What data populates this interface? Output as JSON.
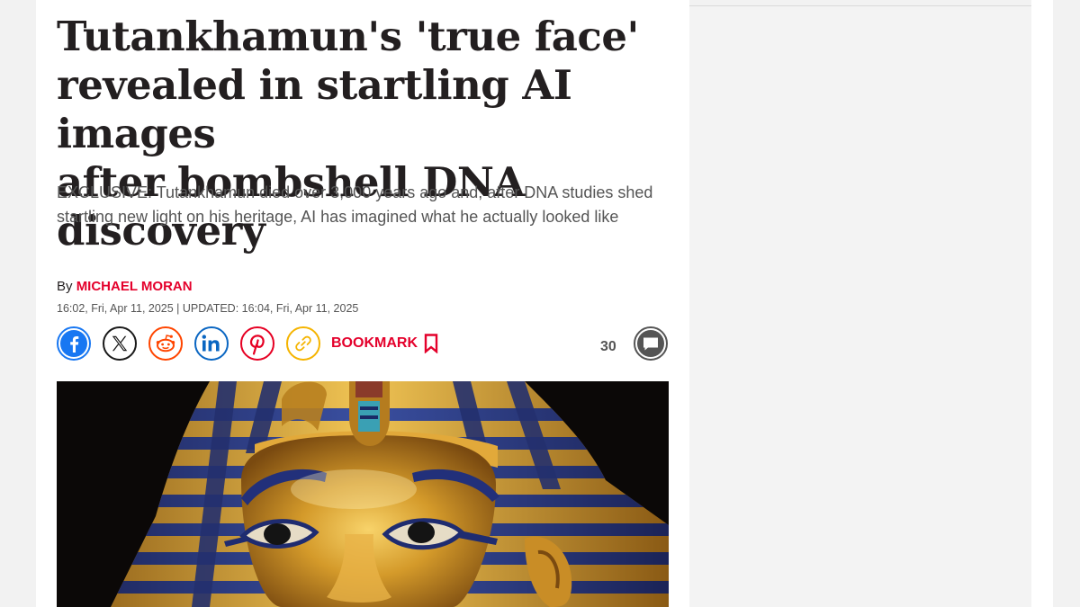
{
  "article": {
    "headline_line1": "Tutankhamun's 'true face'",
    "headline_line2": "revealed in startling AI images",
    "headline_line3": "after bombshell DNA discovery",
    "standfirst": "EXCLUSIVE: Tutankhamun died over 3,000 years ago and, after DNA studies shed startling new light on his heritage, AI has imagined what he actually looked like",
    "byline_prefix": "By",
    "author": "MICHAEL MORAN",
    "timestamp": "16:02, Fri, Apr 11, 2025 | UPDATED: 16:04, Fri, Apr 11, 2025"
  },
  "share": {
    "buttons": [
      {
        "icon": "facebook-icon",
        "color": "#1877f2"
      },
      {
        "icon": "x-icon",
        "color": "#1a1a1a"
      },
      {
        "icon": "reddit-icon",
        "color": "#ff4500"
      },
      {
        "icon": "linkedin-icon",
        "color": "#0a66c2"
      },
      {
        "icon": "pinterest-icon",
        "color": "#e60023"
      },
      {
        "icon": "copy-link-icon",
        "color": "#f5b400"
      }
    ],
    "bookmark_label": "BOOKMARK",
    "bookmark_icon": "bookmark-icon",
    "comment_count": "30",
    "comment_icon": "comment-icon"
  },
  "colors": {
    "brand_red": "#e4002b",
    "headline": "#231f20",
    "body_text": "#555555"
  },
  "hero_image": {
    "subject": "Golden funerary mask of Tutankhamun"
  }
}
